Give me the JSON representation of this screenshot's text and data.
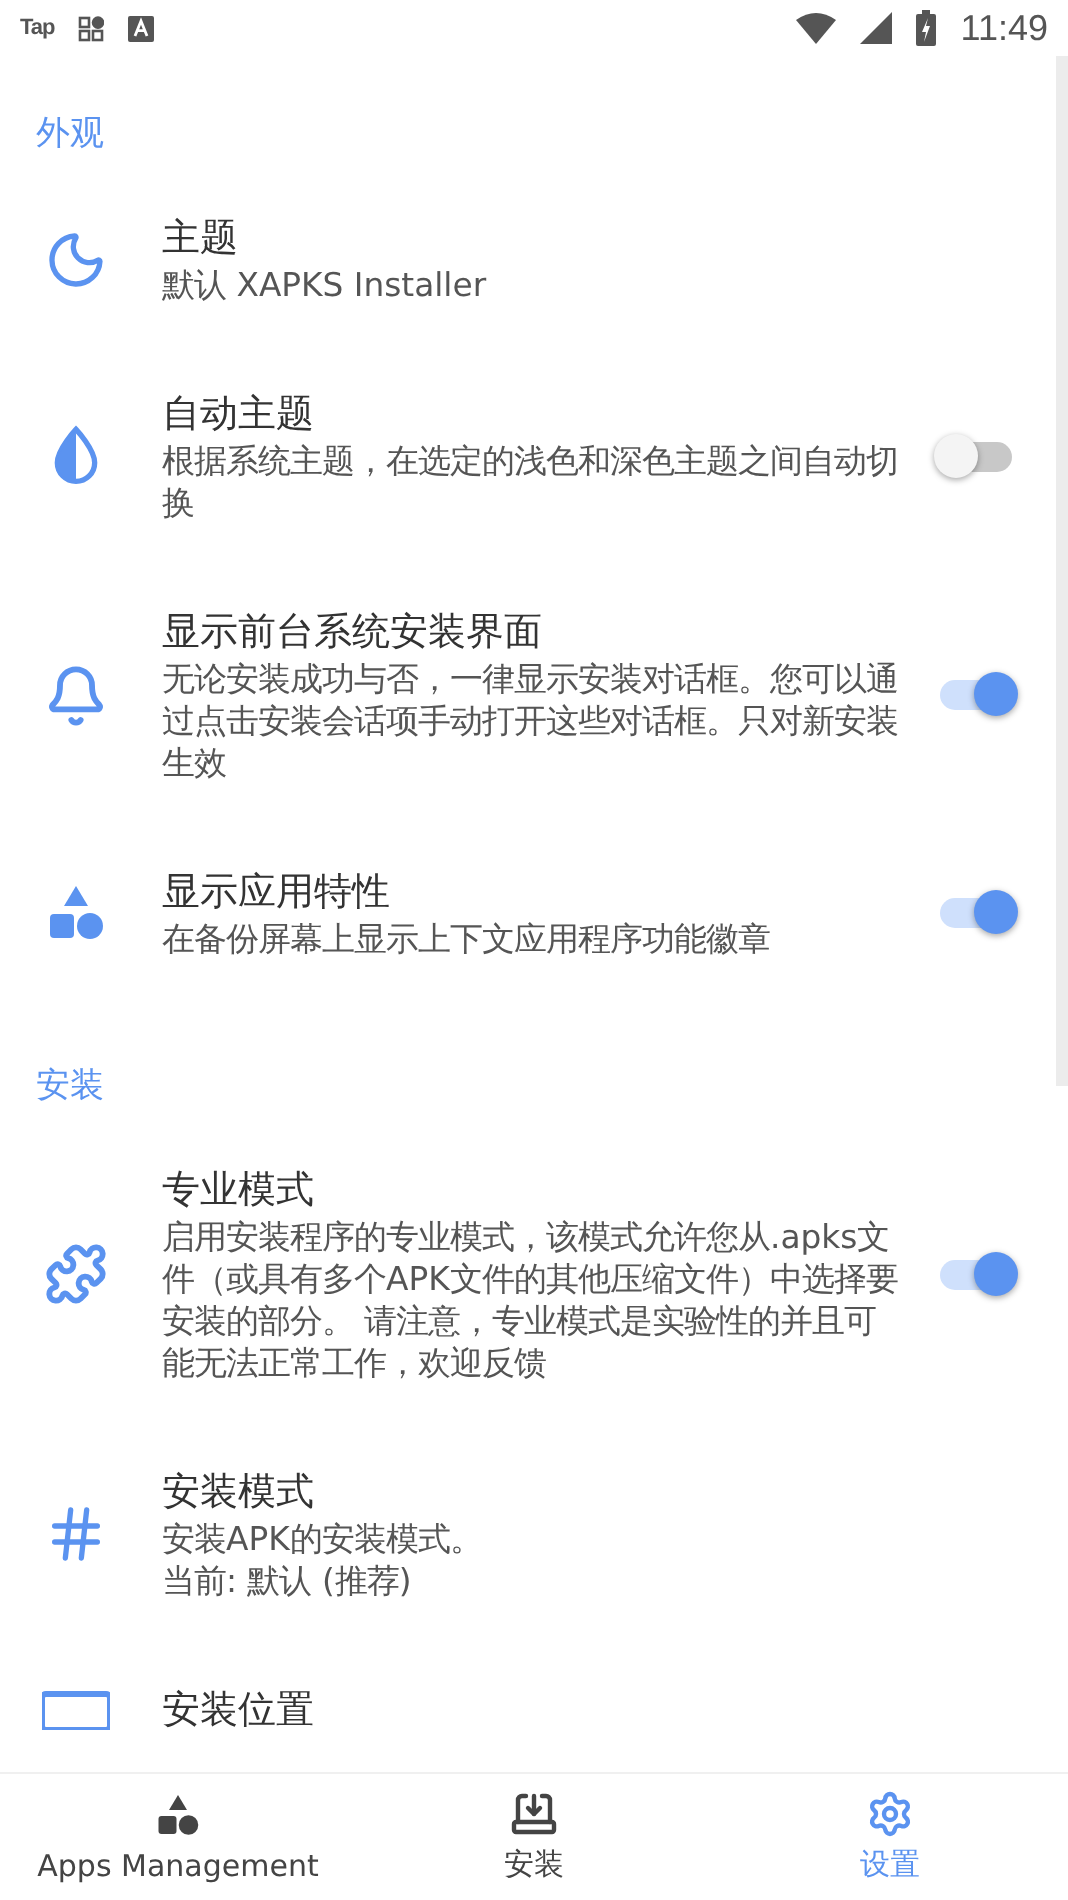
{
  "status_bar": {
    "app_label": "Tap",
    "time": "11:49"
  },
  "sections": [
    {
      "title": "外观",
      "items": [
        {
          "kind": "plain",
          "title": "主题",
          "description": "默认 XAPKS Installer"
        },
        {
          "kind": "switch",
          "title": "自动主题",
          "description": "根据系统主题，在选定的浅色和深色主题之间自动切换",
          "on": false
        },
        {
          "kind": "switch",
          "title": "显示前台系统安装界面",
          "description": "无论安装成功与否，一律显示安装对话框。您可以通过点击安装会话项手动打开这些对话框。只对新安装生效",
          "on": true
        },
        {
          "kind": "switch",
          "title": "显示应用特性",
          "description": "在备份屏幕上显示上下文应用程序功能徽章",
          "on": true
        }
      ]
    },
    {
      "title": "安装",
      "items": [
        {
          "kind": "switch",
          "title": "专业模式",
          "description": "启用安装程序的专业模式，该模式允许您从.apks文件（或具有多个APK文件的其他压缩文件）中选择要安装的部分。 请注意，专业模式是实验性的并且可能无法正常工作，欢迎反馈",
          "on": true
        },
        {
          "kind": "plain",
          "title": "安装模式",
          "description": "安装APK的安装模式。",
          "current": "当前: 默认 (推荐)"
        },
        {
          "kind": "plain",
          "title": "安装位置"
        }
      ]
    }
  ],
  "bottom_nav": [
    {
      "label": "Apps Management",
      "selected": false
    },
    {
      "label": "安装",
      "selected": false
    },
    {
      "label": "设置",
      "selected": true
    }
  ]
}
